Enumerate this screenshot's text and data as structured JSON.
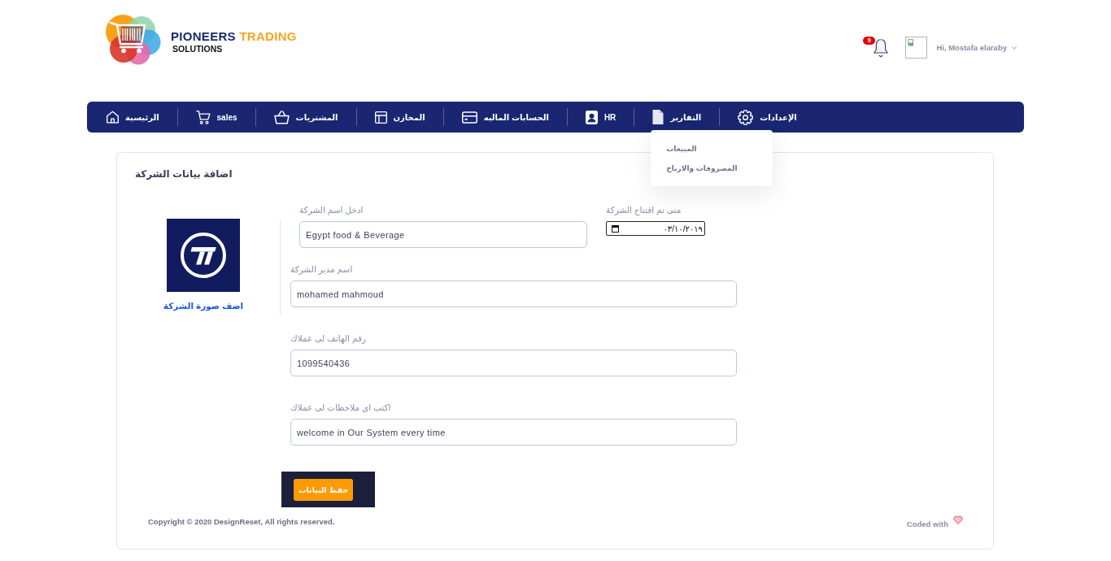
{
  "brand": {
    "name_primary": "PIONEERS",
    "name_secondary": "TRADING",
    "tagline": "SOLUTIONS"
  },
  "header": {
    "notifications": {
      "count": "9"
    },
    "user": {
      "greeting": "Hi, Mostafa elaraby"
    }
  },
  "nav": {
    "items": [
      {
        "label": "الإعدادات"
      },
      {
        "label": "التقارير",
        "submenu": {
          "expanded": true,
          "items": [
            {
              "label": "المبيعات"
            },
            {
              "label": "المصروفات والارباح"
            }
          ]
        }
      },
      {
        "label": "HR"
      },
      {
        "label": "الحسابات الماليه"
      },
      {
        "label": "المخازن"
      },
      {
        "label": "المشتريات"
      },
      {
        "label": "sales"
      },
      {
        "label": "الرئيسية"
      }
    ]
  },
  "card": {
    "title": "اضافة بيانات الشركة",
    "image": {
      "link": "اضف صورة الشركة"
    },
    "rows": [
      {
        "fields": [
          {
            "kind": "date",
            "label": "متى تم افتتاح الشركة",
            "value": "٠٣/١٠/٢٠١٩"
          },
          {
            "kind": "text",
            "label": "ادخل اسم الشركة",
            "value": "Egypt food & Beverage"
          }
        ]
      },
      {
        "fields": [
          {
            "kind": "text",
            "label": "اسم مدير الشركة",
            "value": "mohamed mahmoud"
          }
        ]
      },
      {
        "fields": [
          {
            "kind": "text",
            "label": "رقم الهاتف لى عملاك",
            "value": "1099540436"
          }
        ]
      },
      {
        "fields": [
          {
            "kind": "text",
            "label": "اكتب اى ملاحظات لى عملاك",
            "value": "welcome in Our System every time"
          }
        ]
      }
    ],
    "save_button": "حفظ البيانات"
  },
  "footer": {
    "copyright": "Copyright © 2020 DesignReset, All rights reserved.",
    "credit": "Coded with"
  }
}
